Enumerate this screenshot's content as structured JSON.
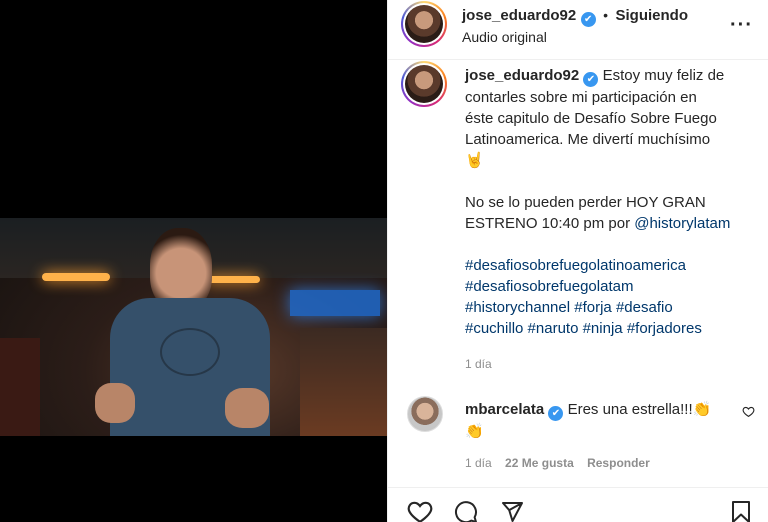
{
  "post_header": {
    "username": "jose_eduardo92",
    "verified_mark": "✔",
    "separator": "•",
    "follow_status": "Siguiendo",
    "audio_label": "Audio original",
    "more_icon": "···"
  },
  "caption": {
    "username": "jose_eduardo92",
    "lines": [
      "Estoy muy feliz de",
      "contarles sobre mi participación en",
      "éste capitulo de Desafío Sobre Fuego",
      "Latinoamerica. Me divertí muchísimo",
      "🤘"
    ],
    "paragraph2_lines": [
      "No se lo pueden perder HOY GRAN",
      "ESTRENO 10:40 pm por "
    ],
    "mention": "@historylatam",
    "hashtag_lines": [
      [
        "#desafiosobrefuegolatinoamerica"
      ],
      [
        "#desafiosobrefuegolatam"
      ],
      [
        "#historychannel",
        "#forja",
        "#desafio"
      ],
      [
        "#cuchillo",
        "#naruto",
        "#ninja",
        "#forjadores"
      ]
    ],
    "time": "1 día"
  },
  "comment": {
    "username": "mbarcelata",
    "text": "Eres una estrella!!!👏",
    "text_line2": "👏",
    "time": "1 día",
    "likes": "22 Me gusta",
    "reply_label": "Responder"
  },
  "icons": {
    "like": "heart-icon",
    "comment": "comment-icon",
    "share": "send-icon",
    "save": "bookmark-icon",
    "comment_like": "small-heart-icon"
  }
}
